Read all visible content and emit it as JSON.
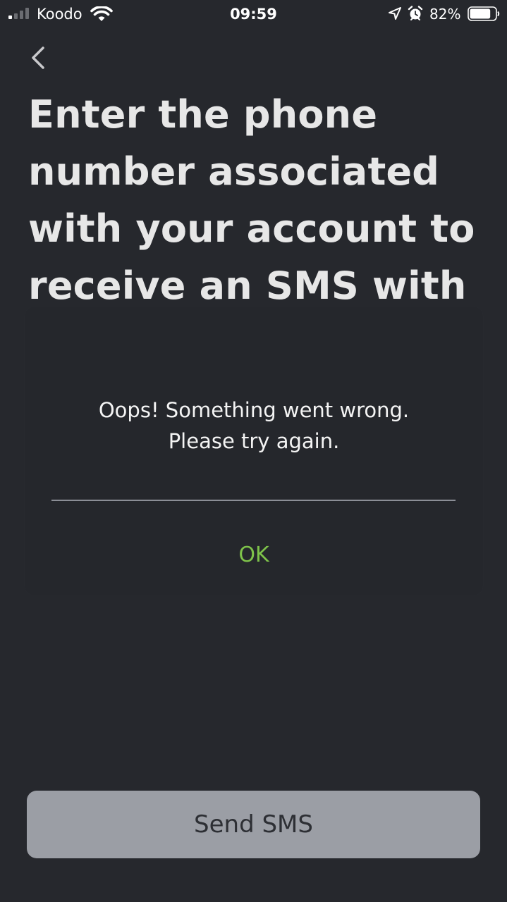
{
  "status_bar": {
    "carrier": "Koodo",
    "time": "09:59",
    "battery_percent": "82%",
    "battery_level": 0.82,
    "signal_bars_active": 1,
    "signal_bars_total": 4,
    "icons": [
      "signal-icon",
      "wifi-icon",
      "location-arrow-icon",
      "alarm-clock-icon",
      "battery-icon"
    ]
  },
  "header": {
    "back_icon": "chevron-left-icon",
    "title": "Enter the phone number associated with your account to receive an SMS with"
  },
  "dialog": {
    "message_line1": "Oops! Something went wrong.",
    "message_line2": "Please try again.",
    "ok_label": "OK"
  },
  "footer": {
    "send_label": "Send SMS"
  },
  "colors": {
    "background": "#26282d",
    "dialog_background": "#25272c",
    "accent_green": "#7ec24a",
    "button_disabled": "#9b9ea5"
  }
}
